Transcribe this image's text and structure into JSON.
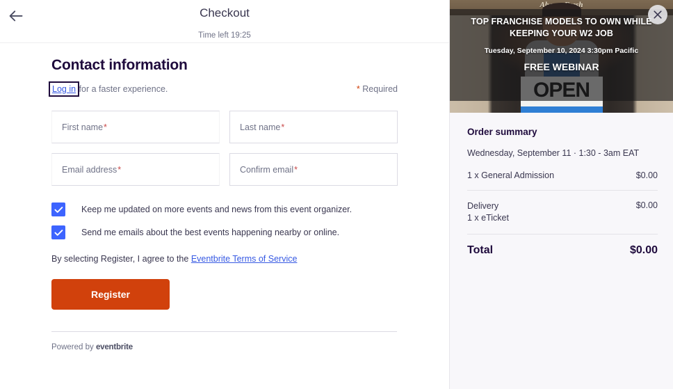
{
  "header": {
    "back_icon": "arrow-left-icon",
    "title": "Checkout",
    "time_left": "Time left 19:25"
  },
  "contact": {
    "section_title": "Contact information",
    "login_link": "Log in",
    "login_suffix": " for a faster experience.",
    "required_star": "*",
    "required_label": " Required",
    "fields": [
      {
        "placeholder": "First name",
        "required_mark": "*",
        "value": "",
        "style": "underline"
      },
      {
        "placeholder": "Last name",
        "required_mark": "*",
        "value": "",
        "style": "boxed"
      },
      {
        "placeholder": "Email address",
        "required_mark": "*",
        "value": "",
        "style": "underline"
      },
      {
        "placeholder": "Confirm email",
        "required_mark": "*",
        "value": "",
        "style": "boxed"
      }
    ],
    "checkboxes": [
      {
        "label": "Keep me updated on more events and news from this event organizer.",
        "checked": true
      },
      {
        "label": "Send me emails about the best events happening nearby or online.",
        "checked": true
      }
    ],
    "terms_prefix": "By selecting Register, I agree to the ",
    "terms_link": "Eventbrite Terms of Service",
    "register_label": "Register"
  },
  "footer": {
    "powered_by": "Powered by ",
    "brand": "eventbrite"
  },
  "promo": {
    "close_icon": "close-icon",
    "store_sign_text": "Always Fresh",
    "open_sign_text": "OPEN",
    "headline": "TOP FRANCHISE MODELS TO OWN WHILE KEEPING YOUR W2 JOB",
    "date": "Tuesday, September 10, 2024 3:30pm Pacific",
    "cta": "FREE WEBINAR"
  },
  "summary": {
    "title": "Order summary",
    "event_datetime": "Wednesday, September 11 · 1:30 - 3am EAT",
    "items": [
      {
        "label": "1 x General Admission",
        "price": "$0.00"
      }
    ],
    "delivery": {
      "label": "Delivery",
      "sublabel": "1 x eTicket",
      "price": "$0.00"
    },
    "total_label": "Total",
    "total_price": "$0.00"
  },
  "colors": {
    "brand_orange": "#d1410c",
    "link_blue": "#3659e3",
    "checkbox_blue": "#3d64ff",
    "required_red": "#c94a4a",
    "panel_bg": "#f8f7fa",
    "text_dark": "#1e0a3c",
    "text_muted": "#6f7287"
  }
}
